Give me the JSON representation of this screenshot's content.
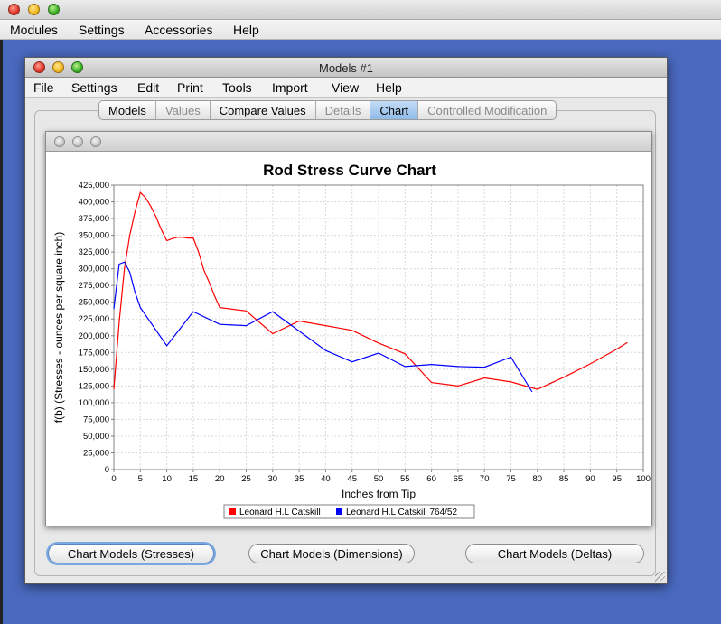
{
  "outer_menu": [
    "Modules",
    "Settings",
    "Accessories",
    "Help"
  ],
  "window": {
    "title": "Models #1",
    "menu": [
      "File",
      "Settings",
      "Edit",
      "Print",
      "Tools",
      "Import",
      "View",
      "Help"
    ],
    "tabs": [
      {
        "label": "Models",
        "state": "enabled"
      },
      {
        "label": "Values",
        "state": "disabled"
      },
      {
        "label": "Compare Values",
        "state": "enabled"
      },
      {
        "label": "Details",
        "state": "disabled"
      },
      {
        "label": "Chart",
        "state": "selected"
      },
      {
        "label": "Controlled Modification",
        "state": "disabled"
      }
    ],
    "buttons": {
      "stresses": "Chart Models (Stresses)",
      "dimensions": "Chart Models (Dimensions)",
      "deltas": "Chart Models (Deltas)"
    }
  },
  "colors": {
    "desktop": "#4a6ac0",
    "selected_tab": "#9cc4ee",
    "series_red": "#ff0000",
    "series_blue": "#0000ff"
  },
  "chart_data": {
    "type": "line",
    "title": "Rod Stress Curve Chart",
    "xlabel": "Inches from Tip",
    "ylabel": "f(b) (Stresses - ounces per square inch)",
    "xlim": [
      0,
      100
    ],
    "ylim": [
      0,
      425000
    ],
    "xticks": [
      0,
      5,
      10,
      15,
      20,
      25,
      30,
      35,
      40,
      45,
      50,
      55,
      60,
      65,
      70,
      75,
      80,
      85,
      90,
      95,
      100
    ],
    "yticks": [
      0,
      25000,
      50000,
      75000,
      100000,
      125000,
      150000,
      175000,
      200000,
      225000,
      250000,
      275000,
      300000,
      325000,
      350000,
      375000,
      400000,
      425000
    ],
    "xtick_labels": [
      "0",
      "5",
      "10",
      "15",
      "20",
      "25",
      "30",
      "35",
      "40",
      "45",
      "50",
      "55",
      "60",
      "65",
      "70",
      "75",
      "80",
      "85",
      "90",
      "95",
      "100"
    ],
    "ytick_labels": [
      "0",
      "25,000",
      "50,000",
      "75,000",
      "100,000",
      "125,000",
      "150,000",
      "175,000",
      "200,000",
      "225,000",
      "250,000",
      "275,000",
      "300,000",
      "325,000",
      "350,000",
      "375,000",
      "400,000",
      "425,000"
    ],
    "grid": true,
    "legend_position": "bottom",
    "series": [
      {
        "name": "Leonard H.L Catskill",
        "color": "#ff0000",
        "x": [
          0,
          1,
          2,
          3,
          4,
          5,
          6,
          7,
          8,
          9,
          10,
          11,
          12,
          13,
          14,
          15,
          16,
          17,
          18,
          19,
          20,
          25,
          30,
          35,
          40,
          45,
          50,
          55,
          60,
          65,
          70,
          75,
          80,
          85,
          90,
          95,
          97
        ],
        "y": [
          120000,
          220000,
          300000,
          350000,
          385000,
          414000,
          406000,
          393000,
          377000,
          358000,
          342000,
          345000,
          347000,
          347000,
          346000,
          346000,
          325000,
          298000,
          280000,
          260000,
          242000,
          237000,
          203000,
          222000,
          215000,
          208000,
          189000,
          173000,
          130000,
          125000,
          137000,
          131000,
          120000,
          138000,
          158000,
          180000,
          190000
        ]
      },
      {
        "name": "Leonard H.L Catskill 764/52",
        "color": "#0000ff",
        "x": [
          0,
          1,
          2,
          3,
          4,
          5,
          10,
          15,
          20,
          25,
          30,
          35,
          40,
          45,
          50,
          55,
          60,
          65,
          70,
          75,
          79
        ],
        "y": [
          240000,
          307000,
          310000,
          295000,
          265000,
          242000,
          185000,
          236000,
          217000,
          215000,
          236000,
          207000,
          178000,
          161000,
          174000,
          154000,
          157000,
          154000,
          153000,
          168000,
          116000
        ]
      }
    ]
  }
}
